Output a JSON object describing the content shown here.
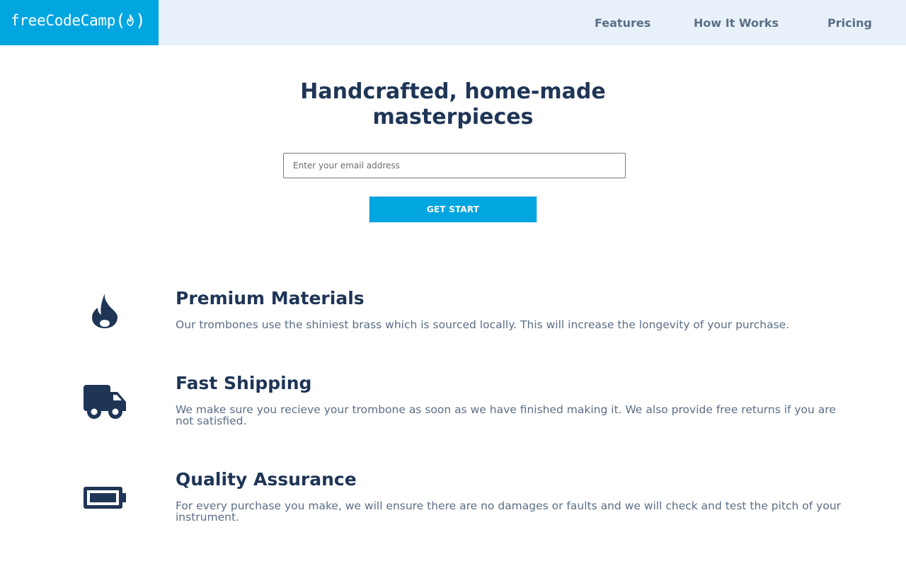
{
  "header": {
    "logo": {
      "text": "freeCodeCamp",
      "open_paren": "(",
      "close_paren": ")",
      "icon": "flame-icon"
    },
    "nav": [
      {
        "label": "Features"
      },
      {
        "label": "How It Works"
      },
      {
        "label": "Pricing"
      }
    ]
  },
  "hero": {
    "title": "Handcrafted, home-made masterpieces",
    "email_placeholder": "Enter your email address",
    "email_value": "",
    "cta_label": "GET START"
  },
  "features": [
    {
      "icon": "fire-icon",
      "title": "Premium Materials",
      "description": "Our trombones use the shiniest brass which is sourced locally. This will increase the longevity of your purchase."
    },
    {
      "icon": "truck-icon",
      "title": "Fast Shipping",
      "description": "We make sure you recieve your trombone as soon as we have finished making it. We also provide free returns if you are not satisfied."
    },
    {
      "icon": "battery-full-icon",
      "title": "Quality Assurance",
      "description": "For every purchase you make, we will ensure there are no damages or faults and we will check and test the pitch of your instrument."
    }
  ],
  "colors": {
    "brand": "#01a5e0",
    "header_bg": "#e8f1fa",
    "heading": "#1f3556",
    "muted_text": "#5b6e86"
  }
}
